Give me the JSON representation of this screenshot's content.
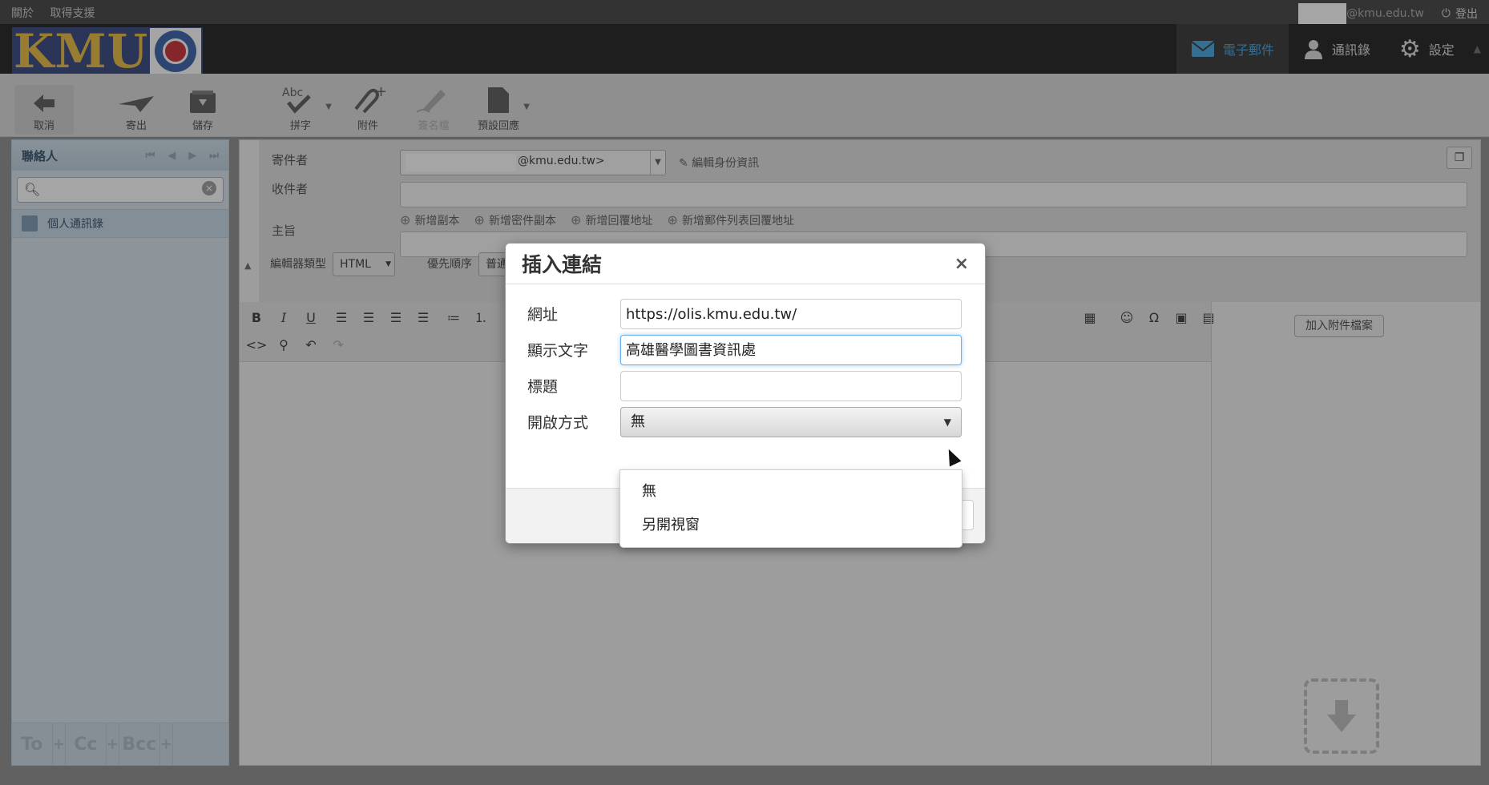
{
  "topbar": {
    "about": "關於",
    "support": "取得支援",
    "user_email_suffix": "@kmu.edu.tw",
    "logout": "登出"
  },
  "logo": {
    "text": "KMU"
  },
  "nav": {
    "mail": "電子郵件",
    "addressbook": "通訊錄",
    "settings": "設定"
  },
  "toolbar": {
    "cancel": "取消",
    "send": "寄出",
    "save": "儲存",
    "spell": "拼字",
    "attach": "附件",
    "signature": "簽名檔",
    "responses": "預設回應"
  },
  "contacts": {
    "title": "聯絡人",
    "addressbook": "個人通訊錄",
    "to": "To",
    "cc": "Cc",
    "bcc": "Bcc"
  },
  "compose": {
    "from_label": "寄件者",
    "from_value": "@kmu.edu.tw>",
    "edit_identity": "編輯身份資訊",
    "to_label": "收件者",
    "add_cc": "新增副本",
    "add_bcc": "新增密件副本",
    "add_replyto": "新增回覆地址",
    "add_followupto": "新增郵件列表回覆地址",
    "subject_label": "主旨",
    "editor_type_label": "編輯器類型",
    "editor_type_value": "HTML",
    "priority_label": "優先順序",
    "priority_value": "普通",
    "attach_button": "加入附件檔案"
  },
  "dialog": {
    "title": "插入連結",
    "close": "×",
    "url_label": "網址",
    "url_value": "https://olis.kmu.edu.tw/",
    "text_label": "顯示文字",
    "text_value": "高雄醫學圖書資訊處",
    "title_label": "標題",
    "title_value": "",
    "target_label": "開啟方式",
    "target_value": "無",
    "target_options": [
      "無",
      "另開視窗"
    ]
  }
}
